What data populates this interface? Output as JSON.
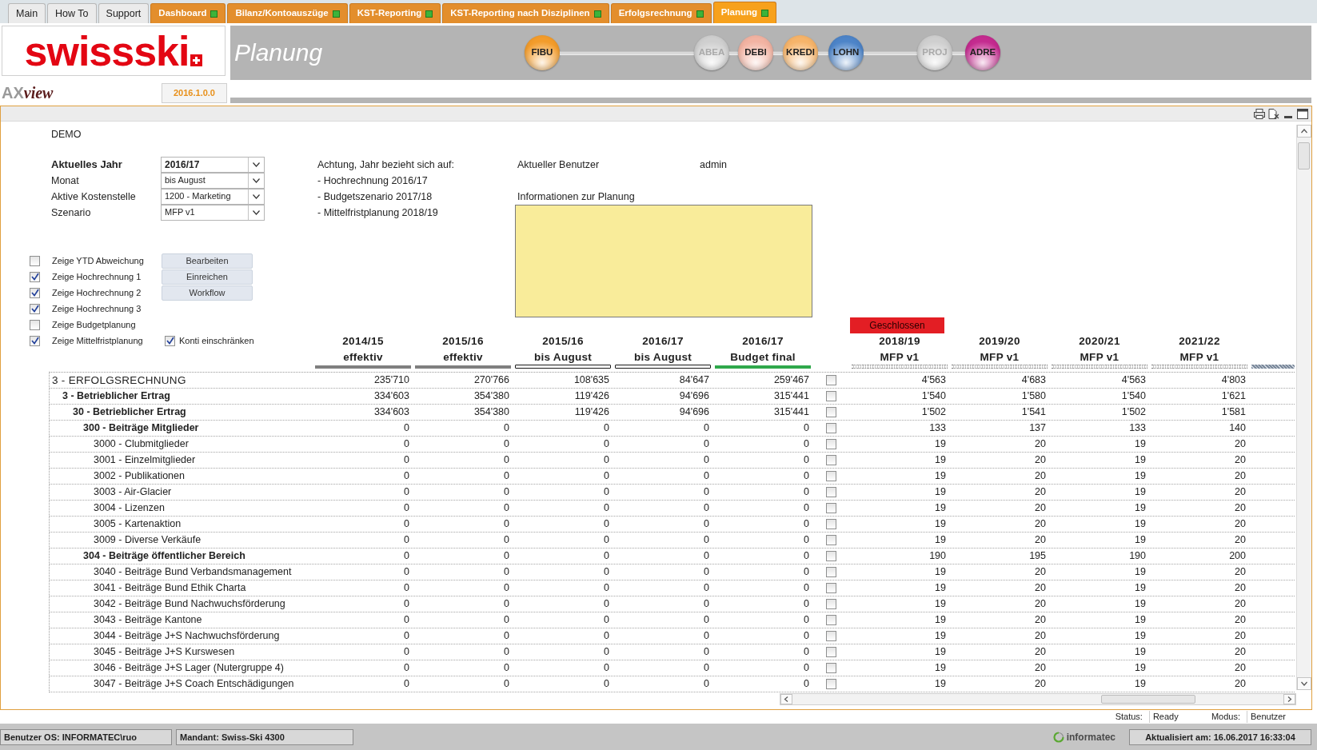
{
  "tabs": [
    {
      "label": "Main",
      "kind": "plain",
      "selected": false
    },
    {
      "label": "How To",
      "kind": "plain",
      "selected": false
    },
    {
      "label": "Support",
      "kind": "plain",
      "selected": false
    },
    {
      "label": "Dashboard",
      "kind": "module",
      "selected": false
    },
    {
      "label": "Bilanz/Kontoauszüge",
      "kind": "module",
      "selected": false
    },
    {
      "label": "KST-Reporting",
      "kind": "module",
      "selected": false
    },
    {
      "label": "KST-Reporting nach Disziplinen",
      "kind": "module",
      "selected": false
    },
    {
      "label": "Erfolgsrechnung",
      "kind": "module",
      "selected": false
    },
    {
      "label": "Planung",
      "kind": "module",
      "selected": true
    }
  ],
  "logo": {
    "brand": "swissski",
    "product_prefix": "AX",
    "product_suffix": "view",
    "version": "2016.1.0.0"
  },
  "banner": {
    "title": "Planung",
    "modules": [
      {
        "label": "FIBU",
        "color": "#f39c2b",
        "disabled": false
      },
      {
        "label": "ABEA",
        "color": "#cfcfcf",
        "disabled": true
      },
      {
        "label": "DEBI",
        "color": "#f2b3a2",
        "disabled": false
      },
      {
        "label": "KREDI",
        "color": "#f6b46a",
        "disabled": false
      },
      {
        "label": "LOHN",
        "color": "#4d84c8",
        "disabled": false
      },
      {
        "label": "PROJ",
        "color": "#cfcfcf",
        "disabled": true
      },
      {
        "label": "ADRE",
        "color": "#c42b8f",
        "disabled": false
      }
    ]
  },
  "demo": "DEMO",
  "filters": [
    {
      "label": "Aktuelles Jahr",
      "value": "2016/17",
      "kind": "main"
    },
    {
      "label": "Monat",
      "value": "bis August",
      "kind": "normal"
    },
    {
      "label": "Aktive Kostenstelle",
      "value": "1200 - Marketing",
      "kind": "normal"
    },
    {
      "label": "Szenario",
      "value": "MFP v1",
      "kind": "normal"
    }
  ],
  "notice": {
    "title": "Achtung, Jahr bezieht sich auf:",
    "lines": [
      "- Hochrechnung 2016/17",
      "- Budgetszenario 2017/18",
      "- Mittelfristplanung 2018/19"
    ]
  },
  "user": {
    "label": "Aktueller Benutzer",
    "value": "admin"
  },
  "info": {
    "label": "Informationen zur Planung"
  },
  "options": [
    {
      "label": "Zeige YTD Abweichung",
      "checked": false
    },
    {
      "label": "Zeige Hochrechnung 1",
      "checked": true
    },
    {
      "label": "Zeige Hochrechnung 2",
      "checked": true
    },
    {
      "label": "Zeige Hochrechnung 3",
      "checked": true
    },
    {
      "label": "Zeige Budgetplanung",
      "checked": false
    },
    {
      "label": "Zeige Mittelfristplanung",
      "checked": true
    }
  ],
  "actions": [
    "Bearbeiten",
    "Einreichen",
    "Workflow"
  ],
  "restrict": {
    "label": "Konti einschränken",
    "checked": true
  },
  "table": {
    "columns": [
      {
        "year": "2014/15",
        "label": "effektiv",
        "kind": "actual"
      },
      {
        "year": "2015/16",
        "label": "effektiv",
        "kind": "actual"
      },
      {
        "year": "2015/16",
        "label": "bis August",
        "kind": "partial"
      },
      {
        "year": "2016/17",
        "label": "bis August",
        "kind": "partial"
      },
      {
        "year": "2016/17",
        "label": "Budget final",
        "kind": "budget"
      },
      {
        "year": "2018/19",
        "label": "MFP v1",
        "kind": "plan",
        "status": "Geschlossen"
      },
      {
        "year": "2019/20",
        "label": "MFP v1",
        "kind": "plan"
      },
      {
        "year": "2020/21",
        "label": "MFP v1",
        "kind": "plan"
      },
      {
        "year": "2021/22",
        "label": "MFP v1",
        "kind": "plan"
      }
    ],
    "rows": [
      {
        "label": "3 - ERFOLGSRECHNUNG",
        "values": [
          "235'710",
          "270'766",
          "108'635",
          "84'647",
          "259'467",
          "4'563",
          "4'683",
          "4'563",
          "4'803"
        ],
        "checked": false,
        "children": [
          {
            "label": "3 - Betrieblicher Ertrag",
            "values": [
              "334'603",
              "354'380",
              "119'426",
              "94'696",
              "315'441",
              "1'540",
              "1'580",
              "1'540",
              "1'621"
            ],
            "checked": false,
            "children": [
              {
                "label": "30 - Betrieblicher Ertrag",
                "values": [
                  "334'603",
                  "354'380",
                  "119'426",
                  "94'696",
                  "315'441",
                  "1'502",
                  "1'541",
                  "1'502",
                  "1'581"
                ],
                "checked": false,
                "children": [
                  {
                    "label": "300 - Beiträge Mitglieder",
                    "values": [
                      "0",
                      "0",
                      "0",
                      "0",
                      "0",
                      "133",
                      "137",
                      "133",
                      "140"
                    ],
                    "checked": false,
                    "children": [
                      {
                        "label": "3000 - Clubmitglieder",
                        "values": [
                          "0",
                          "0",
                          "0",
                          "0",
                          "0",
                          "19",
                          "20",
                          "19",
                          "20"
                        ],
                        "checked": false
                      },
                      {
                        "label": "3001 - Einzelmitglieder",
                        "values": [
                          "0",
                          "0",
                          "0",
                          "0",
                          "0",
                          "19",
                          "20",
                          "19",
                          "20"
                        ],
                        "checked": false
                      },
                      {
                        "label": "3002 - Publikationen",
                        "values": [
                          "0",
                          "0",
                          "0",
                          "0",
                          "0",
                          "19",
                          "20",
                          "19",
                          "20"
                        ],
                        "checked": false
                      },
                      {
                        "label": "3003 - Air-Glacier",
                        "values": [
                          "0",
                          "0",
                          "0",
                          "0",
                          "0",
                          "19",
                          "20",
                          "19",
                          "20"
                        ],
                        "checked": false
                      },
                      {
                        "label": "3004 - Lizenzen",
                        "values": [
                          "0",
                          "0",
                          "0",
                          "0",
                          "0",
                          "19",
                          "20",
                          "19",
                          "20"
                        ],
                        "checked": false
                      },
                      {
                        "label": "3005 - Kartenaktion",
                        "values": [
                          "0",
                          "0",
                          "0",
                          "0",
                          "0",
                          "19",
                          "20",
                          "19",
                          "20"
                        ],
                        "checked": false
                      },
                      {
                        "label": "3009 - Diverse Verkäufe",
                        "values": [
                          "0",
                          "0",
                          "0",
                          "0",
                          "0",
                          "19",
                          "20",
                          "19",
                          "20"
                        ],
                        "checked": false
                      }
                    ]
                  },
                  {
                    "label": "304 - Beiträge öffentlicher Bereich",
                    "values": [
                      "0",
                      "0",
                      "0",
                      "0",
                      "0",
                      "190",
                      "195",
                      "190",
                      "200"
                    ],
                    "checked": false,
                    "children": [
                      {
                        "label": "3040 - Beiträge Bund Verbandsmanagement",
                        "values": [
                          "0",
                          "0",
                          "0",
                          "0",
                          "0",
                          "19",
                          "20",
                          "19",
                          "20"
                        ],
                        "checked": false
                      },
                      {
                        "label": "3041 - Beiträge Bund Ethik Charta",
                        "values": [
                          "0",
                          "0",
                          "0",
                          "0",
                          "0",
                          "19",
                          "20",
                          "19",
                          "20"
                        ],
                        "checked": false
                      },
                      {
                        "label": "3042 - Beiträge Bund Nachwuchsförderung",
                        "values": [
                          "0",
                          "0",
                          "0",
                          "0",
                          "0",
                          "19",
                          "20",
                          "19",
                          "20"
                        ],
                        "checked": false
                      },
                      {
                        "label": "3043 - Beiträge Kantone",
                        "values": [
                          "0",
                          "0",
                          "0",
                          "0",
                          "0",
                          "19",
                          "20",
                          "19",
                          "20"
                        ],
                        "checked": false
                      },
                      {
                        "label": "3044 - Beiträge J+S Nachwuchsförderung",
                        "values": [
                          "0",
                          "0",
                          "0",
                          "0",
                          "0",
                          "19",
                          "20",
                          "19",
                          "20"
                        ],
                        "checked": false
                      },
                      {
                        "label": "3045 - Beiträge J+S Kurswesen",
                        "values": [
                          "0",
                          "0",
                          "0",
                          "0",
                          "0",
                          "19",
                          "20",
                          "19",
                          "20"
                        ],
                        "checked": false
                      },
                      {
                        "label": "3046 - Beiträge J+S Lager (Nutergruppe 4)",
                        "values": [
                          "0",
                          "0",
                          "0",
                          "0",
                          "0",
                          "19",
                          "20",
                          "19",
                          "20"
                        ],
                        "checked": false
                      },
                      {
                        "label": "3047 - Beiträge J+S Coach Entschädigungen",
                        "values": [
                          "0",
                          "0",
                          "0",
                          "0",
                          "0",
                          "19",
                          "20",
                          "19",
                          "20"
                        ],
                        "checked": false
                      }
                    ]
                  }
                ]
              }
            ]
          }
        ]
      }
    ]
  },
  "status_line": {
    "status_label": "Status:",
    "status": "Ready",
    "mode_label": "Modus:",
    "mode": "Benutzer"
  },
  "footer": {
    "os_user": "Benutzer OS: INFORMATEC\\ruo",
    "mandant": "Mandant: Swiss-Ski 4300",
    "vendor": "informatec",
    "updated": "Aktualisiert am: 16.06.2017 16:33:04"
  }
}
